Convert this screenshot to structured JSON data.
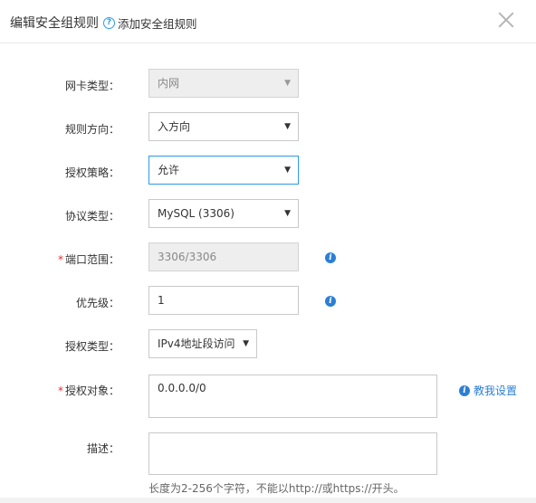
{
  "dialog": {
    "title": "编辑安全组规则",
    "help_link": "添加安全组规则",
    "help_icon": "question-circle-icon",
    "close_icon": "close-icon"
  },
  "form": {
    "nic_type": {
      "label": "网卡类型：",
      "value": "内网"
    },
    "direction": {
      "label": "规则方向：",
      "value": "入方向"
    },
    "policy": {
      "label": "授权策略：",
      "value": "允许"
    },
    "protocol": {
      "label": "协议类型：",
      "value": "MySQL (3306)"
    },
    "port_range": {
      "label": "端口范围：",
      "value": "3306/3306",
      "required": true
    },
    "priority": {
      "label": "优先级：",
      "value": "1"
    },
    "auth_type": {
      "label": "授权类型：",
      "value": "IPv4地址段访问"
    },
    "auth_object": {
      "label": "授权对象：",
      "value": "0.0.0.0/0",
      "required": true,
      "help_link": "教我设置"
    },
    "description": {
      "label": "描述：",
      "value": "",
      "hint": "长度为2-256个字符，不能以http://或https://开头。"
    }
  },
  "colors": {
    "accent": "#2b7fd4",
    "required": "#e0332d",
    "focus_border": "#2b9be7"
  }
}
